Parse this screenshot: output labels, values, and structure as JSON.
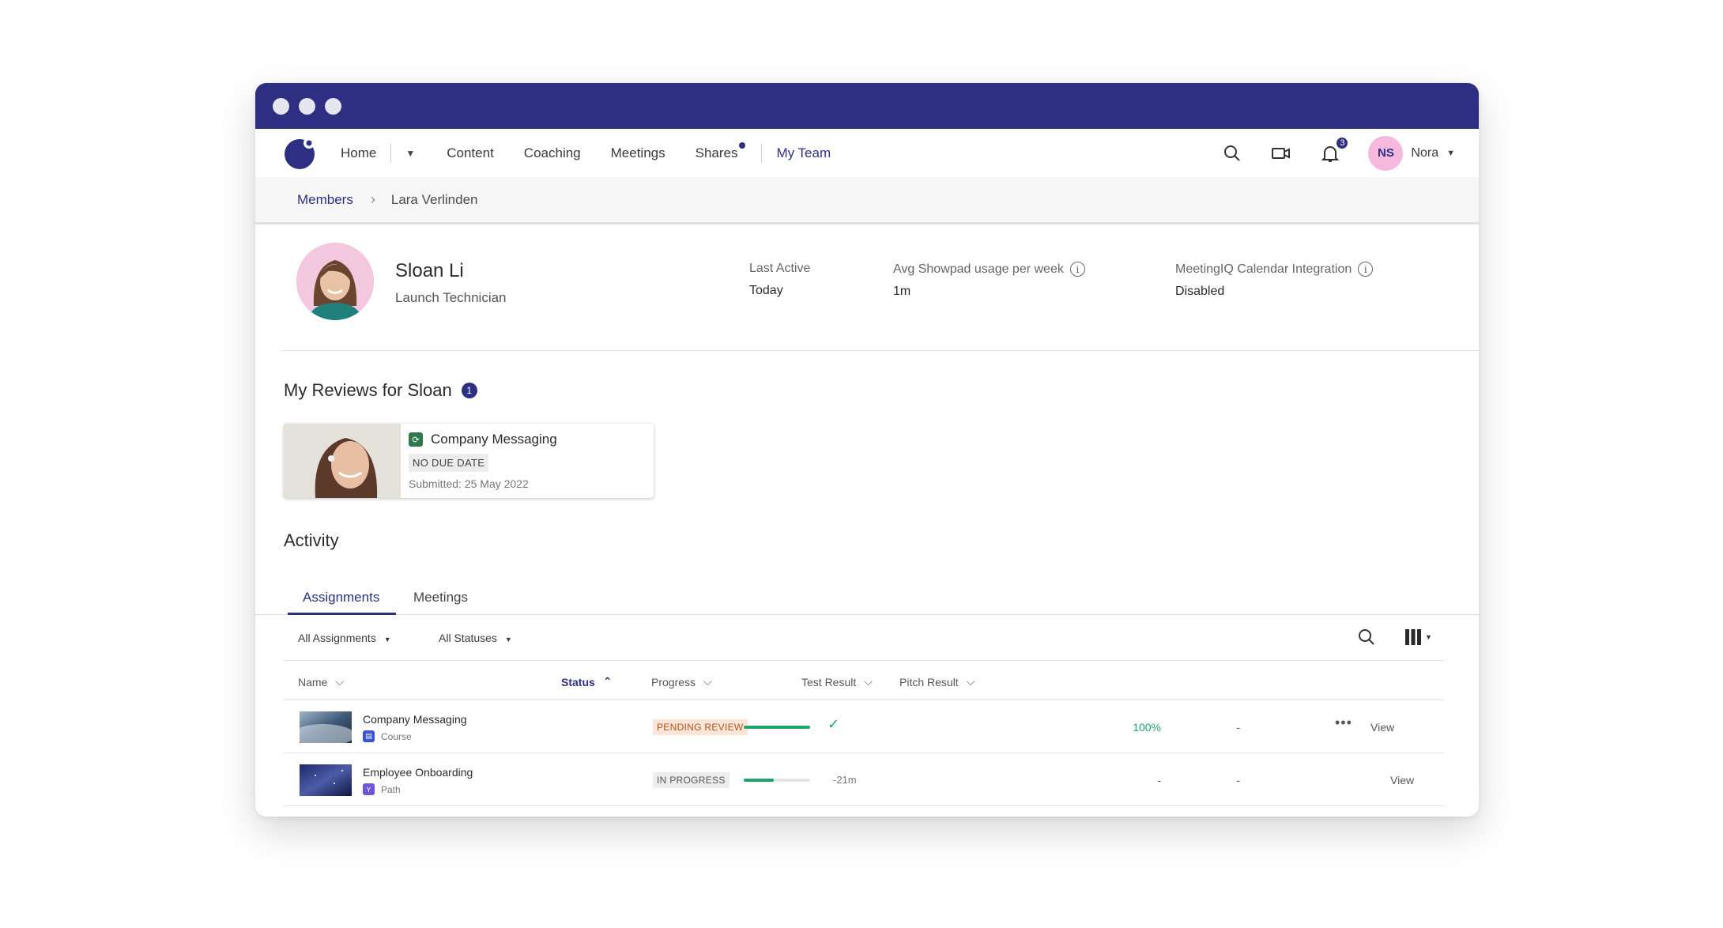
{
  "nav": {
    "items": [
      "Home",
      "Content",
      "Coaching",
      "Meetings",
      "Shares",
      "My Team"
    ],
    "notification_count": "3",
    "user_initials": "NS",
    "user_name": "Nora"
  },
  "breadcrumb": {
    "parent": "Members",
    "current": "Lara Verlinden"
  },
  "profile": {
    "name": "Sloan Li",
    "title": "Launch Technician",
    "stats": [
      {
        "label": "Last Active",
        "value": "Today"
      },
      {
        "label": "Avg Showpad usage per week",
        "value": "1m"
      },
      {
        "label": "MeetingIQ Calendar Integration",
        "value": "Disabled"
      }
    ]
  },
  "reviews": {
    "title": "My Reviews for Sloan",
    "count": "1",
    "card": {
      "title": "Company Messaging",
      "tag": "NO DUE DATE",
      "date": "Submitted: 25 May 2022"
    }
  },
  "activity": {
    "title": "Activity",
    "tabs": [
      "Assignments",
      "Meetings"
    ],
    "filters": [
      "All Assignments",
      "All Statuses"
    ],
    "columns": [
      "Name",
      "Status",
      "Progress",
      "Test Result",
      "Pitch Result"
    ],
    "rows": [
      {
        "name": "Company Messaging",
        "type": "Course",
        "status": "PENDING REVIEW",
        "progress": 1.0,
        "eta": "",
        "test": "100%",
        "pitch": "-",
        "action": "View"
      },
      {
        "name": "Employee Onboarding",
        "type": "Path",
        "status": "IN PROGRESS",
        "progress": 0.45,
        "eta": "-21m",
        "test": "-",
        "pitch": "-",
        "action": "View"
      }
    ]
  },
  "colors": {
    "brand": "#2e2f82",
    "success": "#1fa46b",
    "pending_bg": "#fde6d7"
  }
}
